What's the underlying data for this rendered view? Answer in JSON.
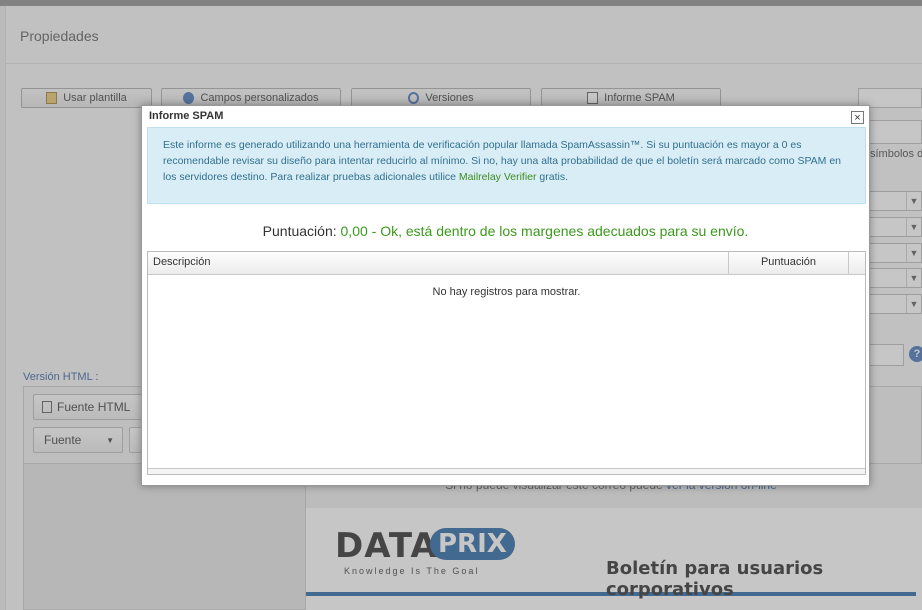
{
  "panel": {
    "title": "Propiedades"
  },
  "toolbar": {
    "template": "Usar plantilla",
    "custom_fields": "Campos personalizados",
    "versions": "Versiones",
    "spam_report": "Informe SPAM"
  },
  "right_panel": {
    "partial_label": "símbolos de"
  },
  "html_section": {
    "label": "Versión HTML :",
    "source_button": "Fuente HTML",
    "font_select": "Fuente"
  },
  "preview": {
    "online_text": "Si no puede visualizar este correo puede ",
    "online_link": "ver la versión on-line",
    "logo_main": "DATA",
    "logo_accent": "PRIX",
    "logo_tagline": "Knowledge Is The Goal",
    "banner_title": "Boletín para usuarios corporativos"
  },
  "dialog": {
    "title": "Informe SPAM",
    "close": "×",
    "info_text": "Este informe es generado utilizando una herramienta de verificación popular llamada SpamAssassin™. Si su puntuación es mayor a 0 es recomendable revisar su diseño para intentar reducirlo al mínimo. Si no, hay una alta probabilidad de que el boletín será marcado como SPAM en los servidores destino. Para realizar pruebas adicionales utilice ",
    "info_link": "Mailrelay Verifier",
    "info_suffix": " gratis.",
    "score_label": "Puntuación: ",
    "score_value": "0,00 - Ok, está dentro de los margenes adecuados para su envío.",
    "grid": {
      "columns": [
        "Descripción",
        "Puntuación"
      ],
      "empty_text": "No hay registros para mostrar."
    }
  },
  "colors": {
    "accent_blue": "#1d5fa0",
    "ok_green": "#3b9a1c",
    "info_bg": "#d9edf6",
    "info_text": "#31708f"
  }
}
